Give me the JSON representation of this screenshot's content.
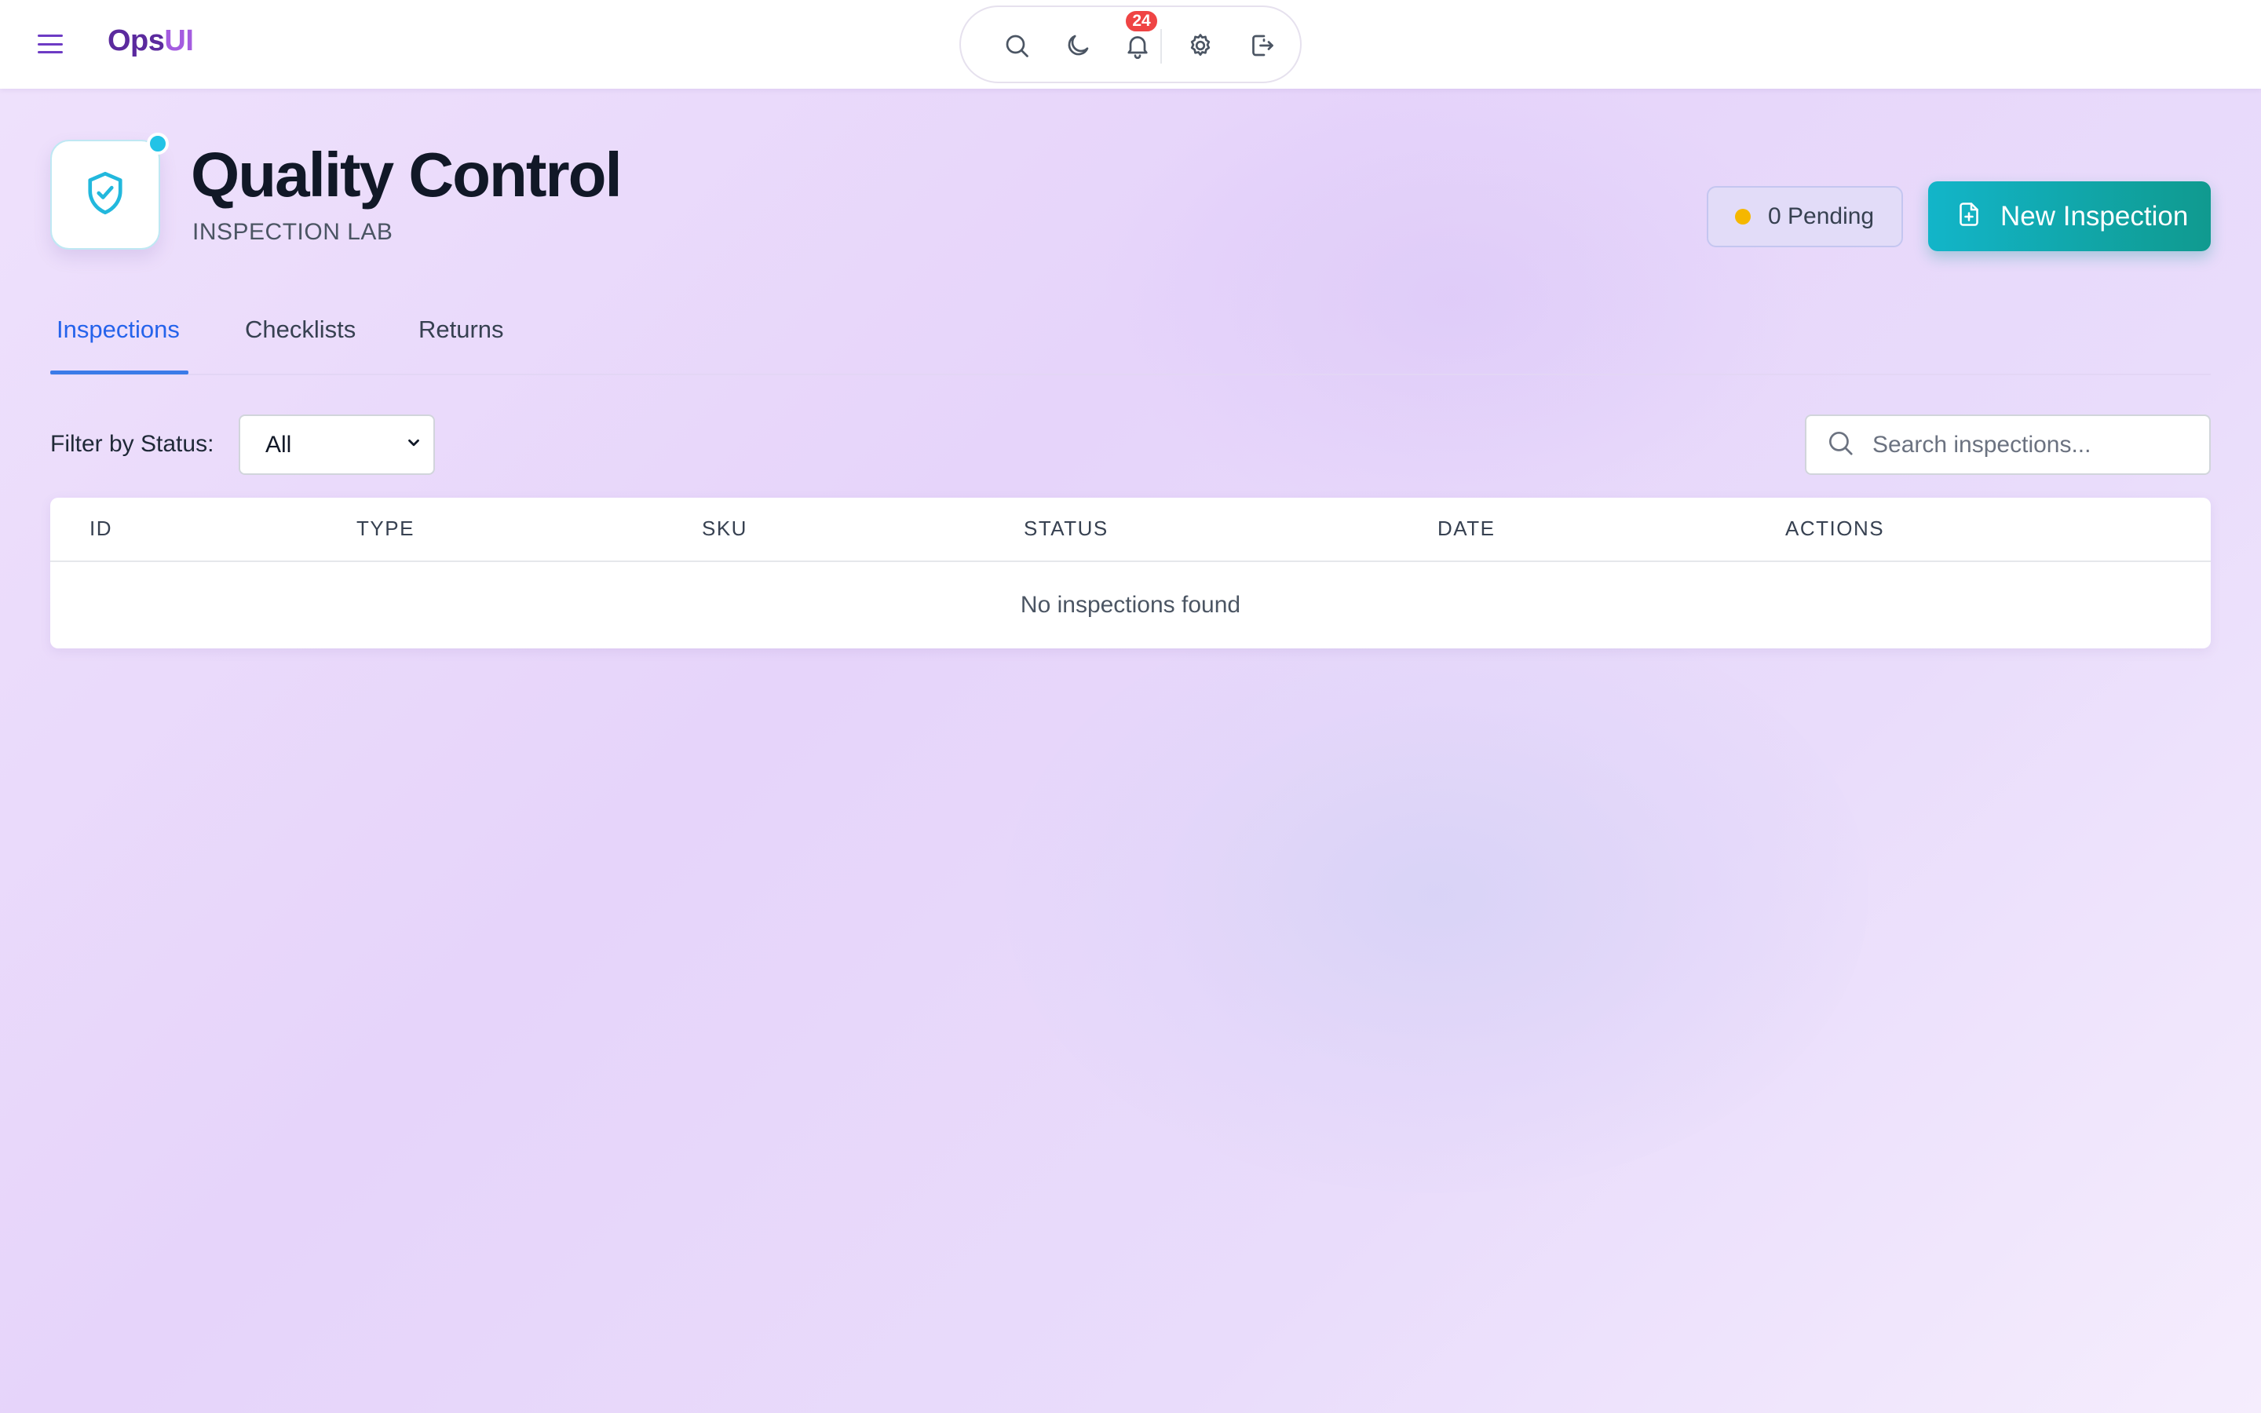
{
  "app": {
    "brand_part1": "Ops",
    "brand_part2": "UI",
    "notification_count": "24"
  },
  "header": {
    "title": "Quality Control",
    "subtitle": "INSPECTION LAB",
    "pending_label": "0 Pending",
    "new_button_label": "New Inspection"
  },
  "tabs": [
    {
      "label": "Inspections",
      "active": true
    },
    {
      "label": "Checklists",
      "active": false
    },
    {
      "label": "Returns",
      "active": false
    }
  ],
  "filter": {
    "label": "Filter by Status:",
    "selected": "All"
  },
  "search": {
    "placeholder": "Search inspections..."
  },
  "table": {
    "columns": [
      "ID",
      "TYPE",
      "SKU",
      "STATUS",
      "DATE",
      "ACTIONS"
    ],
    "empty_message": "No inspections found"
  },
  "icons": {
    "menu": "menu-icon",
    "search": "search-icon",
    "theme": "moon-icon",
    "notifications": "bell-icon",
    "settings": "gear-icon",
    "logout": "logout-icon",
    "logo": "shield-check-icon",
    "new_doc": "file-plus-icon"
  },
  "colors": {
    "brand_primary": "#5b2a9e",
    "brand_secondary": "#a45ce0",
    "accent_teal": "#12b5c9",
    "active_tab": "#2563eb",
    "pending_dot": "#f5b700",
    "badge": "#ef4444"
  }
}
